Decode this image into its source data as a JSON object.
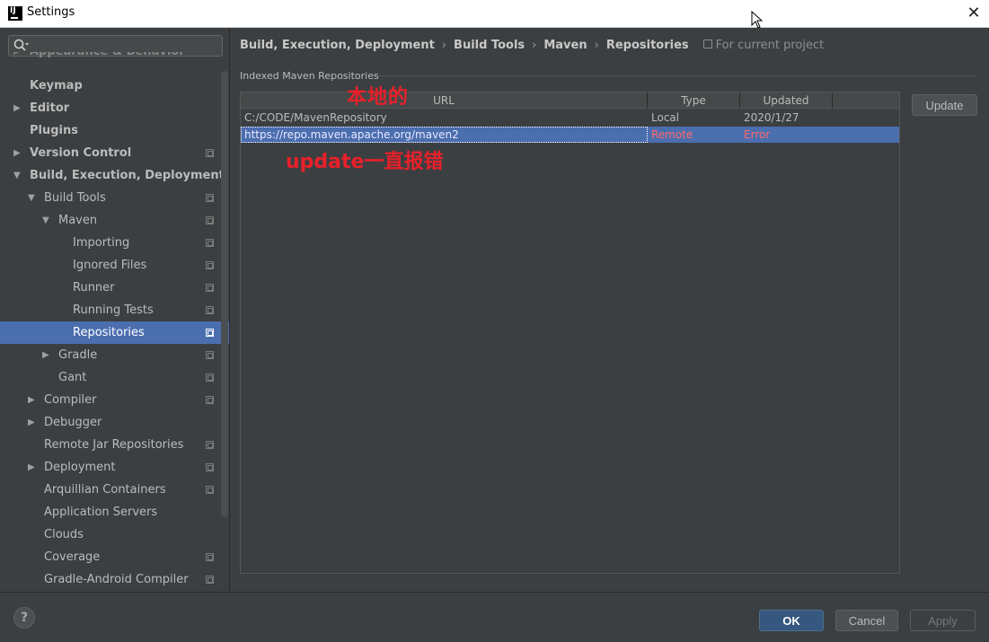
{
  "window": {
    "title": "Settings",
    "close": "✕"
  },
  "search": {
    "icon": "search-icon",
    "value": ""
  },
  "tree": [
    {
      "label": "Appearance & Behavior",
      "bold": true,
      "level": 0,
      "arrow": "▶",
      "proj": false,
      "cut": true
    },
    {
      "label": "Keymap",
      "bold": true,
      "level": 0,
      "arrow": "",
      "proj": false
    },
    {
      "label": "Editor",
      "bold": true,
      "level": 0,
      "arrow": "▶",
      "proj": false
    },
    {
      "label": "Plugins",
      "bold": true,
      "level": 0,
      "arrow": "",
      "proj": false
    },
    {
      "label": "Version Control",
      "bold": true,
      "level": 0,
      "arrow": "▶",
      "proj": true
    },
    {
      "label": "Build, Execution, Deployment",
      "bold": true,
      "level": 0,
      "arrow": "▼",
      "proj": false
    },
    {
      "label": "Build Tools",
      "bold": false,
      "level": 1,
      "arrow": "▼",
      "proj": true
    },
    {
      "label": "Maven",
      "bold": false,
      "level": 2,
      "arrow": "▼",
      "proj": true
    },
    {
      "label": "Importing",
      "bold": false,
      "level": 3,
      "arrow": "",
      "proj": true
    },
    {
      "label": "Ignored Files",
      "bold": false,
      "level": 3,
      "arrow": "",
      "proj": true
    },
    {
      "label": "Runner",
      "bold": false,
      "level": 3,
      "arrow": "",
      "proj": true
    },
    {
      "label": "Running Tests",
      "bold": false,
      "level": 3,
      "arrow": "",
      "proj": true
    },
    {
      "label": "Repositories",
      "bold": false,
      "level": 3,
      "arrow": "",
      "proj": true,
      "selected": true
    },
    {
      "label": "Gradle",
      "bold": false,
      "level": 2,
      "arrow": "▶",
      "proj": true
    },
    {
      "label": "Gant",
      "bold": false,
      "level": 2,
      "arrow": "",
      "proj": true
    },
    {
      "label": "Compiler",
      "bold": false,
      "level": 1,
      "arrow": "▶",
      "proj": true
    },
    {
      "label": "Debugger",
      "bold": false,
      "level": 1,
      "arrow": "▶",
      "proj": false
    },
    {
      "label": "Remote Jar Repositories",
      "bold": false,
      "level": 1,
      "arrow": "",
      "proj": true
    },
    {
      "label": "Deployment",
      "bold": false,
      "level": 1,
      "arrow": "▶",
      "proj": true
    },
    {
      "label": "Arquillian Containers",
      "bold": false,
      "level": 1,
      "arrow": "",
      "proj": true
    },
    {
      "label": "Application Servers",
      "bold": false,
      "level": 1,
      "arrow": "",
      "proj": false
    },
    {
      "label": "Clouds",
      "bold": false,
      "level": 1,
      "arrow": "",
      "proj": false
    },
    {
      "label": "Coverage",
      "bold": false,
      "level": 1,
      "arrow": "",
      "proj": true
    },
    {
      "label": "Gradle-Android Compiler",
      "bold": false,
      "level": 1,
      "arrow": "",
      "proj": true
    }
  ],
  "breadcrumb": {
    "items": [
      "Build, Execution, Deployment",
      "Build Tools",
      "Maven",
      "Repositories"
    ],
    "separator": "›",
    "scope": "For current project"
  },
  "section": {
    "title": "Indexed Maven Repositories"
  },
  "table": {
    "columns": [
      "URL",
      "Type",
      "Updated"
    ],
    "rows": [
      {
        "url": "C:/CODE/MavenRepository",
        "type": "Local",
        "updated": "2020/1/27",
        "selected": false
      },
      {
        "url": "https://repo.maven.apache.org/maven2",
        "type": "Remote",
        "updated": "Error",
        "selected": true
      }
    ]
  },
  "annotations": {
    "local": "本地的",
    "update_error": "update一直报错"
  },
  "buttons": {
    "update": "Update",
    "ok": "OK",
    "cancel": "Cancel",
    "apply": "Apply",
    "help": "?"
  },
  "colors": {
    "selection": "#4b6eaf",
    "background": "#3c3f41",
    "annotation": "#e8202a",
    "ok_button": "#365880"
  }
}
